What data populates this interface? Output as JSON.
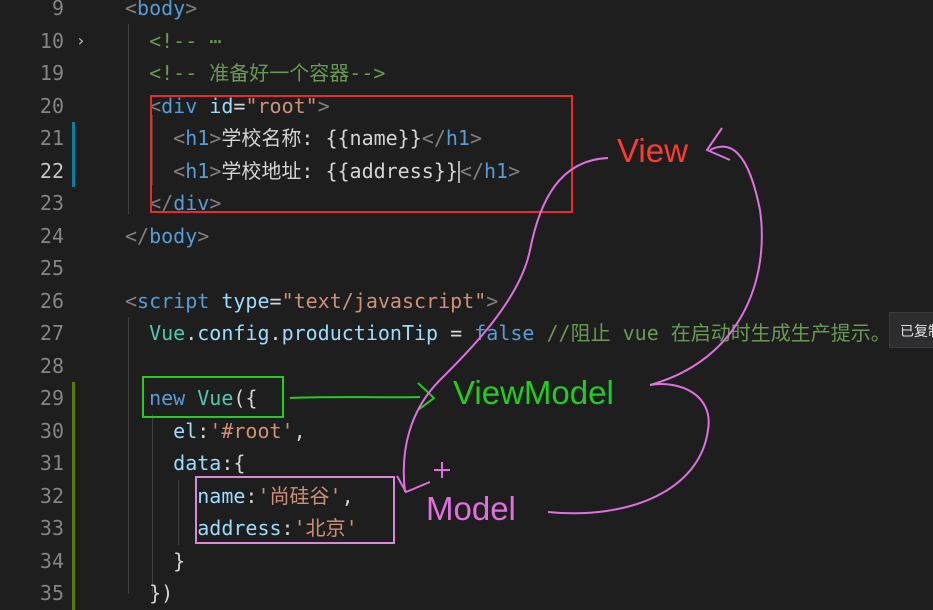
{
  "editor": {
    "lines": [
      {
        "num": "9",
        "tokens": [
          [
            "t-punc",
            "<"
          ],
          [
            "t-tag",
            "body"
          ],
          [
            "t-punc",
            ">"
          ]
        ]
      },
      {
        "num": "10",
        "fold": "›",
        "tokens": [
          [
            "t-com",
            "  <!-- ⋯"
          ]
        ]
      },
      {
        "num": "19",
        "tokens": [
          [
            "t-com",
            "  <!-- 准备好一个容器-->"
          ]
        ]
      },
      {
        "num": "20",
        "tokens": [
          [
            "t-w",
            "  "
          ],
          [
            "t-punc",
            "<"
          ],
          [
            "t-tag",
            "div"
          ],
          [
            "t-w",
            " "
          ],
          [
            "t-attr",
            "id"
          ],
          [
            "t-w",
            "="
          ],
          [
            "t-str",
            "\"root\""
          ],
          [
            "t-punc",
            ">"
          ]
        ]
      },
      {
        "num": "21",
        "mod": "blue",
        "tokens": [
          [
            "t-w",
            "    "
          ],
          [
            "t-punc",
            "<"
          ],
          [
            "t-tag",
            "h1"
          ],
          [
            "t-punc",
            ">"
          ],
          [
            "t-w",
            "学校名称: {{name}}"
          ],
          [
            "t-punc",
            "</"
          ],
          [
            "t-tag",
            "h1"
          ],
          [
            "t-punc",
            ">"
          ]
        ]
      },
      {
        "num": "22",
        "mod": "blue",
        "active": true,
        "tokens": [
          [
            "t-w",
            "    "
          ],
          [
            "t-punc",
            "<"
          ],
          [
            "t-tag",
            "h1"
          ],
          [
            "t-punc",
            ">"
          ],
          [
            "t-w",
            "学校地址: {{address}}"
          ],
          [
            "cur",
            ""
          ],
          [
            "t-punc",
            "</"
          ],
          [
            "t-tag",
            "h1"
          ],
          [
            "t-punc",
            ">"
          ]
        ]
      },
      {
        "num": "23",
        "tokens": [
          [
            "t-w",
            "  "
          ],
          [
            "t-punc",
            "</"
          ],
          [
            "t-tag",
            "div"
          ],
          [
            "t-punc",
            ">"
          ]
        ]
      },
      {
        "num": "24",
        "tokens": [
          [
            "t-punc",
            "</"
          ],
          [
            "t-tag",
            "body"
          ],
          [
            "t-punc",
            ">"
          ]
        ]
      },
      {
        "num": "25",
        "tokens": []
      },
      {
        "num": "26",
        "tokens": [
          [
            "t-punc",
            "<"
          ],
          [
            "t-tag",
            "script"
          ],
          [
            "t-w",
            " "
          ],
          [
            "t-attr",
            "type"
          ],
          [
            "t-w",
            "="
          ],
          [
            "t-str",
            "\"text/javascript\""
          ],
          [
            "t-punc",
            ">"
          ]
        ]
      },
      {
        "num": "27",
        "tokens": [
          [
            "t-w",
            "  "
          ],
          [
            "t-cls",
            "Vue"
          ],
          [
            "t-w",
            "."
          ],
          [
            "t-prop",
            "config"
          ],
          [
            "t-w",
            "."
          ],
          [
            "t-prop",
            "productionTip"
          ],
          [
            "t-w",
            " = "
          ],
          [
            "t-kw",
            "false"
          ],
          [
            "t-w",
            " "
          ],
          [
            "t-com",
            "//阻止 vue 在启动时生成生产提示。"
          ]
        ]
      },
      {
        "num": "28",
        "tokens": []
      },
      {
        "num": "29",
        "mod": "green",
        "tokens": [
          [
            "t-w",
            "  "
          ],
          [
            "t-kw",
            "new"
          ],
          [
            "t-w",
            " "
          ],
          [
            "t-cls",
            "Vue"
          ],
          [
            "t-w",
            "({"
          ]
        ]
      },
      {
        "num": "30",
        "mod": "green",
        "tokens": [
          [
            "t-w",
            "    "
          ],
          [
            "t-keyname",
            "el"
          ],
          [
            "t-w",
            ":"
          ],
          [
            "t-str",
            "'#root'"
          ],
          [
            "t-w",
            ","
          ]
        ]
      },
      {
        "num": "31",
        "mod": "green",
        "tokens": [
          [
            "t-w",
            "    "
          ],
          [
            "t-keyname",
            "data"
          ],
          [
            "t-w",
            ":{"
          ]
        ]
      },
      {
        "num": "32",
        "mod": "green",
        "tokens": [
          [
            "t-w",
            "      "
          ],
          [
            "t-keyname",
            "name"
          ],
          [
            "t-w",
            ":"
          ],
          [
            "t-str",
            "'尚硅谷'"
          ],
          [
            "t-w",
            ","
          ]
        ]
      },
      {
        "num": "33",
        "mod": "green",
        "tokens": [
          [
            "t-w",
            "      "
          ],
          [
            "t-keyname",
            "address"
          ],
          [
            "t-w",
            ":"
          ],
          [
            "t-str",
            "'北京'"
          ]
        ]
      },
      {
        "num": "34",
        "mod": "green",
        "tokens": [
          [
            "t-w",
            "    }"
          ]
        ]
      },
      {
        "num": "35",
        "mod": "green",
        "tokens": [
          [
            "t-w",
            "  })"
          ]
        ]
      }
    ]
  },
  "tooltip": {
    "text": "已复制"
  },
  "annotations": {
    "view": {
      "text": "View",
      "color": "#ff3b30"
    },
    "viewmodel": {
      "text": "ViewModel",
      "color": "#22cc22"
    },
    "model": {
      "text": "Model",
      "color": "#e070e0"
    }
  },
  "colors": {
    "red_box": "#e52b2b",
    "green_box": "#22cc22",
    "pink_box": "#d88ad8",
    "pink_stroke": "#e070e0"
  }
}
